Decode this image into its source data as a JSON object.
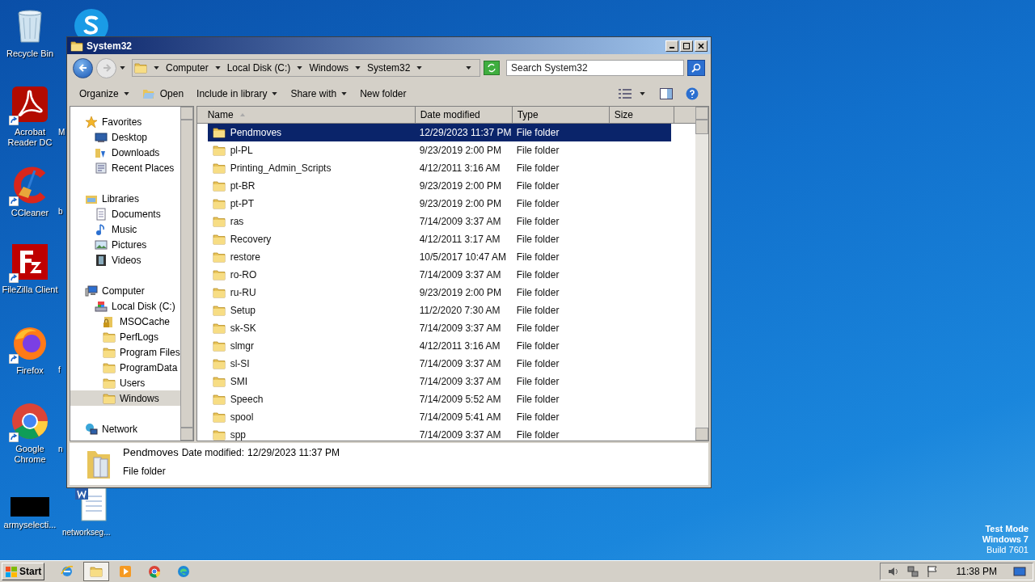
{
  "desktop_icons": [
    {
      "label": "Recycle Bin",
      "kind": "recycle"
    },
    {
      "label": "Acrobat Reader DC",
      "kind": "acrobat"
    },
    {
      "label": "CCleaner",
      "kind": "ccleaner"
    },
    {
      "label": "FileZilla Client",
      "kind": "filezilla"
    },
    {
      "label": "Firefox",
      "kind": "firefox"
    },
    {
      "label": "Google Chrome",
      "kind": "chrome"
    },
    {
      "label": "armyselecti...",
      "kind": "black"
    }
  ],
  "desktop_icons_behind": [
    {
      "kind": "skype"
    },
    {
      "label": "M",
      "kind": "none"
    },
    {
      "label": "b",
      "kind": "none"
    },
    {
      "label": "f",
      "kind": "none"
    },
    {
      "label": "n",
      "kind": "none"
    },
    {
      "label": "networkseg...",
      "kind": "word"
    }
  ],
  "window": {
    "title": "System32",
    "breadcrumb": [
      "Computer",
      "Local Disk (C:)",
      "Windows",
      "System32"
    ],
    "search": {
      "placeholder": "Search System32"
    },
    "toolbar": [
      {
        "label": "Organize",
        "kind": "menu"
      },
      {
        "label": "Open",
        "kind": "open"
      },
      {
        "label": "Include in library",
        "kind": "menu"
      },
      {
        "label": "Share with",
        "kind": "menu"
      },
      {
        "label": "New folder",
        "kind": "plain"
      }
    ],
    "nav": [
      {
        "label": "Favorites",
        "kind": "star",
        "selected": false,
        "children": [
          {
            "label": "Desktop",
            "kind": "desktop",
            "selected": false
          },
          {
            "label": "Downloads",
            "kind": "downloads",
            "selected": false
          },
          {
            "label": "Recent Places",
            "kind": "recent",
            "selected": false
          }
        ]
      },
      {
        "label": "Libraries",
        "kind": "libraries",
        "selected": false,
        "children": [
          {
            "label": "Documents",
            "kind": "documents",
            "selected": false
          },
          {
            "label": "Music",
            "kind": "music",
            "selected": false
          },
          {
            "label": "Pictures",
            "kind": "pictures",
            "selected": false
          },
          {
            "label": "Videos",
            "kind": "videos",
            "selected": false
          }
        ]
      },
      {
        "label": "Computer",
        "kind": "computer",
        "selected": false,
        "children": [
          {
            "label": "Local Disk (C:)",
            "kind": "disk",
            "selected": false,
            "children": [
              {
                "label": "MSOCache",
                "kind": "lockfolder",
                "selected": false
              },
              {
                "label": "PerfLogs",
                "kind": "folder",
                "selected": false
              },
              {
                "label": "Program Files",
                "kind": "folder",
                "selected": false
              },
              {
                "label": "ProgramData",
                "kind": "folder",
                "selected": false
              },
              {
                "label": "Users",
                "kind": "folder",
                "selected": false
              },
              {
                "label": "Windows",
                "kind": "folder",
                "selected": true
              }
            ]
          }
        ]
      },
      {
        "label": "Network",
        "kind": "network",
        "selected": false
      }
    ],
    "columns": [
      "Name",
      "Date modified",
      "Type",
      "Size"
    ],
    "rows": [
      {
        "name": "Pendmoves",
        "date": "12/29/2023 11:37 PM",
        "type": "File folder",
        "selected": true
      },
      {
        "name": "pl-PL",
        "date": "9/23/2019 2:00 PM",
        "type": "File folder",
        "selected": false
      },
      {
        "name": "Printing_Admin_Scripts",
        "date": "4/12/2011 3:16 AM",
        "type": "File folder",
        "selected": false
      },
      {
        "name": "pt-BR",
        "date": "9/23/2019 2:00 PM",
        "type": "File folder",
        "selected": false
      },
      {
        "name": "pt-PT",
        "date": "9/23/2019 2:00 PM",
        "type": "File folder",
        "selected": false
      },
      {
        "name": "ras",
        "date": "7/14/2009 3:37 AM",
        "type": "File folder",
        "selected": false
      },
      {
        "name": "Recovery",
        "date": "4/12/2011 3:17 AM",
        "type": "File folder",
        "selected": false
      },
      {
        "name": "restore",
        "date": "10/5/2017 10:47 AM",
        "type": "File folder",
        "selected": false
      },
      {
        "name": "ro-RO",
        "date": "7/14/2009 3:37 AM",
        "type": "File folder",
        "selected": false
      },
      {
        "name": "ru-RU",
        "date": "9/23/2019 2:00 PM",
        "type": "File folder",
        "selected": false
      },
      {
        "name": "Setup",
        "date": "11/2/2020 7:30 AM",
        "type": "File folder",
        "selected": false
      },
      {
        "name": "sk-SK",
        "date": "7/14/2009 3:37 AM",
        "type": "File folder",
        "selected": false
      },
      {
        "name": "slmgr",
        "date": "4/12/2011 3:16 AM",
        "type": "File folder",
        "selected": false
      },
      {
        "name": "sl-SI",
        "date": "7/14/2009 3:37 AM",
        "type": "File folder",
        "selected": false
      },
      {
        "name": "SMI",
        "date": "7/14/2009 3:37 AM",
        "type": "File folder",
        "selected": false
      },
      {
        "name": "Speech",
        "date": "7/14/2009 5:52 AM",
        "type": "File folder",
        "selected": false
      },
      {
        "name": "spool",
        "date": "7/14/2009 5:41 AM",
        "type": "File folder",
        "selected": false
      },
      {
        "name": "spp",
        "date": "7/14/2009 3:37 AM",
        "type": "File folder",
        "selected": false
      }
    ],
    "details": {
      "name": "Pendmoves",
      "date_label": "Date modified:",
      "date": "12/29/2023 11:37 PM",
      "type": "File folder"
    }
  },
  "taskbar": {
    "start": "Start",
    "apps": [
      {
        "kind": "ie",
        "selected": false
      },
      {
        "kind": "explorer",
        "selected": true
      },
      {
        "kind": "media",
        "selected": false
      },
      {
        "kind": "chrome",
        "selected": false
      },
      {
        "kind": "edge",
        "selected": false
      }
    ],
    "clock": "11:38 PM"
  },
  "os_info": [
    "Test Mode",
    "Windows 7",
    "Build 7601"
  ]
}
